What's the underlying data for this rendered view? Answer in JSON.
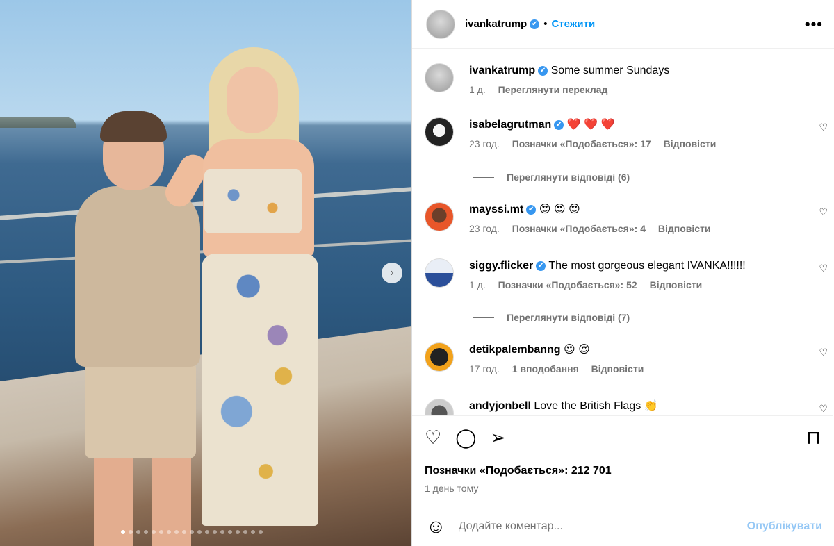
{
  "post": {
    "author": "ivankatrump",
    "follow_label": "Стежити",
    "separator": "•",
    "more_icon": "•••",
    "caption": {
      "user": "ivankatrump",
      "text": "Some summer Sundays",
      "time": "1 д.",
      "translate_label": "Переглянути переклад"
    },
    "comments": [
      {
        "user": "isabelagrutman",
        "verified": true,
        "text": "❤️ ❤️ ❤️",
        "time": "23 год.",
        "likes": "Позначки «Подобається»: 17",
        "reply": "Відповісти",
        "view_replies": "Переглянути відповіді (6)"
      },
      {
        "user": "mayssi.mt",
        "verified": true,
        "text": "😍 😍 😍",
        "time": "23 год.",
        "likes": "Позначки «Подобається»: 4",
        "reply": "Відповісти",
        "view_replies": ""
      },
      {
        "user": "siggy.flicker",
        "verified": true,
        "text": "The most gorgeous elegant IVANKA!!!!!!",
        "time": "1 д.",
        "likes": "Позначки «Подобається»: 52",
        "reply": "Відповісти",
        "view_replies": "Переглянути відповіді (7)"
      },
      {
        "user": "detikpalembanng",
        "verified": false,
        "text": "😍 😍",
        "time": "17 год.",
        "likes": "1 вподобання",
        "reply": "Відповісти",
        "view_replies": ""
      },
      {
        "user": "andyjonbell",
        "verified": false,
        "text": "Love the British Flags 👏",
        "time": "",
        "likes": "",
        "reply": "",
        "view_replies": ""
      }
    ],
    "likes_total": "Позначки «Подобається»: 212 701",
    "posted": "1 день тому",
    "comment_placeholder": "Додайте коментар...",
    "publish_label": "Опублікувати",
    "carousel": {
      "count": 19,
      "active": 0
    }
  },
  "icons": {
    "verified": "✔",
    "heart": "♡",
    "comment": "◯",
    "share": "➢",
    "save": "⊓",
    "emoji": "☺",
    "next": "›"
  }
}
